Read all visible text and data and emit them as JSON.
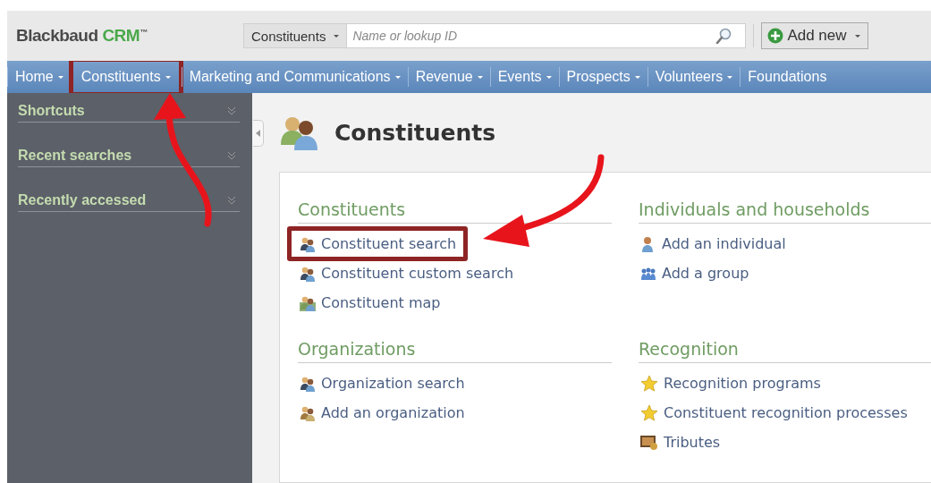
{
  "header": {
    "logo": {
      "name": "Blackbaud",
      "product": "CRM",
      "mark": "™"
    },
    "search_scope": "Constituents",
    "search": {
      "placeholder": "Name or lookup ID"
    },
    "add_button": "Add new"
  },
  "nav": [
    {
      "label": "Home",
      "highlighted": false
    },
    {
      "label": "Constituents",
      "highlighted": true
    },
    {
      "label": "Marketing and Communications",
      "highlighted": false
    },
    {
      "label": "Revenue",
      "highlighted": false
    },
    {
      "label": "Events",
      "highlighted": false
    },
    {
      "label": "Prospects",
      "highlighted": false
    },
    {
      "label": "Volunteers",
      "highlighted": false
    },
    {
      "label": "Foundations",
      "highlighted": false
    }
  ],
  "sidebar": {
    "items": [
      {
        "label": "Shortcuts",
        "expanded": false
      },
      {
        "label": "Recent searches",
        "expanded": false
      },
      {
        "label": "Recently accessed",
        "expanded": false
      }
    ]
  },
  "page": {
    "title": "Constituents",
    "sections": [
      {
        "title": "Constituents",
        "links": [
          {
            "label": "Constituent search",
            "kind": "search",
            "highlighted": true
          },
          {
            "label": "Constituent custom search",
            "kind": "search",
            "highlighted": false
          },
          {
            "label": "Constituent map",
            "kind": "map",
            "highlighted": false
          }
        ]
      },
      {
        "title": "Individuals and households",
        "links": [
          {
            "label": "Add an individual",
            "kind": "person",
            "highlighted": false
          },
          {
            "label": "Add a group",
            "kind": "group",
            "highlighted": false
          }
        ]
      },
      {
        "title": "Organizations",
        "links": [
          {
            "label": "Organization search",
            "kind": "search",
            "highlighted": false
          },
          {
            "label": "Add an organization",
            "kind": "add",
            "highlighted": false
          }
        ]
      },
      {
        "title": "Recognition",
        "links": [
          {
            "label": "Recognition programs",
            "kind": "star",
            "highlighted": false
          },
          {
            "label": "Constituent recognition processes",
            "kind": "star",
            "highlighted": false
          },
          {
            "label": "Tributes",
            "kind": "tribute",
            "highlighted": false
          }
        ]
      }
    ]
  }
}
